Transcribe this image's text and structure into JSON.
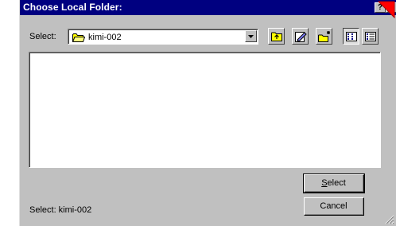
{
  "window": {
    "title": "Choose Local Folder:",
    "help_glyph": "?",
    "close_glyph": "X"
  },
  "location": {
    "label": "Select:",
    "current_folder": "kimi-002"
  },
  "toolbar": {
    "icons": [
      "up-one-level-icon",
      "edit-folder-icon",
      "new-folder-icon",
      "list-view-icon",
      "details-view-icon"
    ]
  },
  "buttons": {
    "select_prefix": "",
    "select_mnemonic": "S",
    "select_rest": "elect",
    "cancel_label": "Cancel"
  },
  "status": {
    "text": "Select: kimi-002"
  },
  "colors": {
    "titlebar": "#000080",
    "face": "#c0c0c0",
    "cursor": "#ff0000",
    "folder": "#ffff00"
  }
}
